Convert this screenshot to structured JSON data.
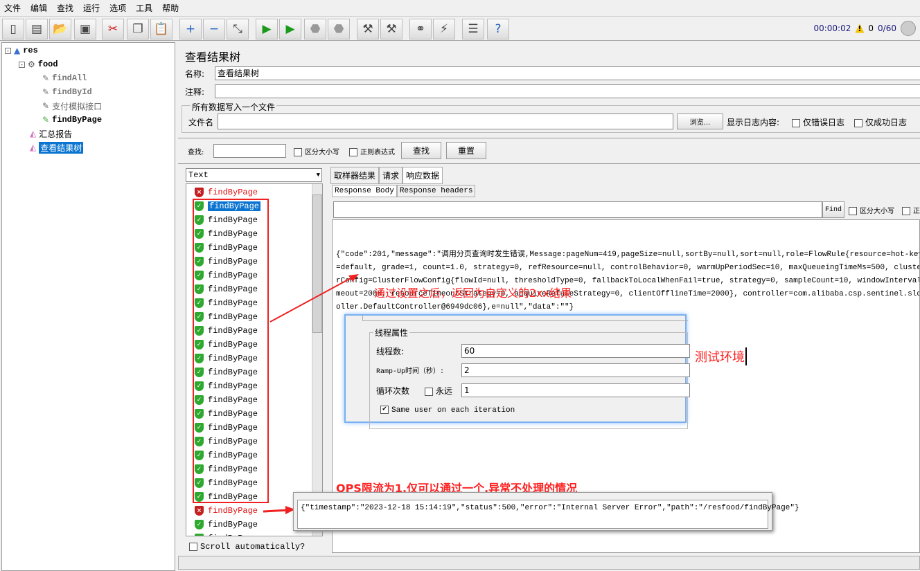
{
  "menu": [
    "文件",
    "编辑",
    "查找",
    "运行",
    "选项",
    "工具",
    "帮助"
  ],
  "toolbar": {
    "icons": [
      "new-icon",
      "templates-icon",
      "open-icon",
      "save-icon",
      "cut-icon",
      "copy-icon",
      "paste-icon",
      "expand-icon",
      "collapse-icon",
      "toggle-icon",
      "start-icon",
      "start-no-pause-icon",
      "stop-icon",
      "shutdown-icon",
      "clear-icon",
      "clear-all-icon",
      "search-icon",
      "reset-search-icon",
      "function-helper-icon",
      "help-icon"
    ]
  },
  "status": {
    "elapsed": "00:00:02",
    "warnings": "0",
    "threads": "0/60"
  },
  "tree": {
    "root": "res",
    "group": "food",
    "samplers": [
      "findAll",
      "findById",
      "支付模拟接口",
      "findByPage"
    ],
    "listeners": [
      "汇总报告",
      "查看结果树"
    ]
  },
  "panel": {
    "title": "查看结果树",
    "name_label": "名称:",
    "name_value": "查看结果树",
    "comment_label": "注释:",
    "file_group": "所有数据写入一个文件",
    "file_label": "文件名",
    "browse": "浏览...",
    "log_label": "显示日志内容:",
    "errors_only": "仅错误日志",
    "success_only": "仅成功日志"
  },
  "search": {
    "label": "查找:",
    "case": "区分大小写",
    "regex": "正则表达式",
    "find": "查找",
    "reset": "重置"
  },
  "results": {
    "renderer": "Text",
    "scroll_auto": "Scroll automatically?",
    "items": [
      {
        "label": "findByPage",
        "status": "error"
      },
      {
        "label": "findByPage",
        "status": "ok",
        "selected": true
      },
      {
        "label": "findByPage",
        "status": "ok"
      },
      {
        "label": "findByPage",
        "status": "ok"
      },
      {
        "label": "findByPage",
        "status": "ok"
      },
      {
        "label": "findByPage",
        "status": "ok"
      },
      {
        "label": "findByPage",
        "status": "ok"
      },
      {
        "label": "findByPage",
        "status": "ok"
      },
      {
        "label": "findByPage",
        "status": "ok"
      },
      {
        "label": "findByPage",
        "status": "ok"
      },
      {
        "label": "findByPage",
        "status": "ok"
      },
      {
        "label": "findByPage",
        "status": "ok"
      },
      {
        "label": "findByPage",
        "status": "ok"
      },
      {
        "label": "findByPage",
        "status": "ok"
      },
      {
        "label": "findByPage",
        "status": "ok"
      },
      {
        "label": "findByPage",
        "status": "ok"
      },
      {
        "label": "findByPage",
        "status": "ok"
      },
      {
        "label": "findByPage",
        "status": "ok"
      },
      {
        "label": "findByPage",
        "status": "ok"
      },
      {
        "label": "findByPage",
        "status": "ok"
      },
      {
        "label": "findByPage",
        "status": "ok"
      },
      {
        "label": "findByPage",
        "status": "ok"
      },
      {
        "label": "findByPage",
        "status": "ok"
      },
      {
        "label": "findByPage",
        "status": "error"
      },
      {
        "label": "findByPage",
        "status": "ok"
      },
      {
        "label": "findByPage",
        "status": "ok"
      }
    ]
  },
  "tabs": [
    "取样器结果",
    "请求",
    "响应数据"
  ],
  "subtabs": [
    "Response Body",
    "Response headers"
  ],
  "find": {
    "button": "Find",
    "case": "区分大小写",
    "regex": "正"
  },
  "response_lines": [
    "{\"code\":201,\"message\":\"调用分页查询时发生错误,Message:pageNum=419,pageSize=null,sortBy=null,sort=null,role=FlowRule{resource=hot-key-page, li",
    "=default, grade=1, count=1.0, strategy=0, refResource=null, controlBehavior=0, warmUpPeriodSec=10, maxQueueingTimeMs=500, clusterMode=false, c",
    "rConfig=ClusterFlowConfig{flowId=null, thresholdType=0, fallbackToLocalWhenFail=true, strategy=0, sampleCount=10, windowIntervalMs=1000, reso",
    "meout=2000, resourceTimeoutStrategy=0, acquireRefuseStrategy=0, clientOfflineTime=2000}, controller=com.alibaba.csp.sentinel.slots.block.flow",
    "oller.DefaultController@6949dc06},e=null\",\"data\":\"\"}"
  ],
  "annotations": {
    "custom_result": "通过设置之后，返回为自定义的2xx结果",
    "test_env": "测试环境",
    "qps_note": "QPS限流为1,仅可以通过一个,异常不处理的情况"
  },
  "thread_props": {
    "title": "线程属性",
    "threads_label": "线程数:",
    "threads": "60",
    "rampup_label": "Ramp-Up时间（秒）:",
    "rampup": "2",
    "loop_label": "循环次数",
    "forever": "永远",
    "loops": "1",
    "same_user": "Same user on each iteration"
  },
  "error_response": "{\"timestamp\":\"2023-12-18 15:14:19\",\"status\":500,\"error\":\"Internal Server Error\",\"path\":\"/resfood/findByPage\"}"
}
